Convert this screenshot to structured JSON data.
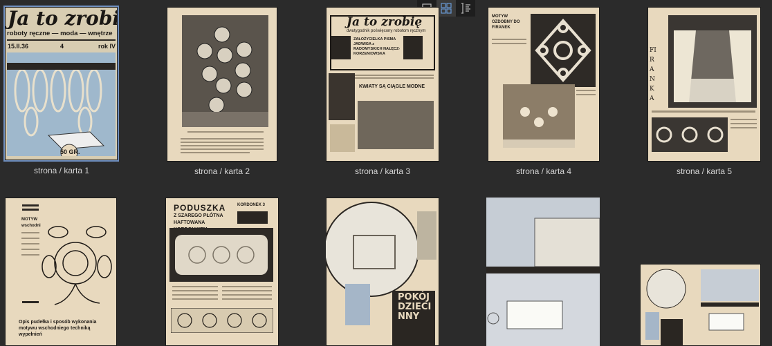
{
  "toolbar": {
    "single_view_label": "single page view",
    "grid_view_label": "grid view",
    "list_view_label": "list view"
  },
  "cover": {
    "title": "Ja to zrobię",
    "subtitle": "roboty ręczne — moda — wnętrze",
    "date": "15.II.36",
    "issue": "4",
    "year": "rok IV",
    "price": "50 GR."
  },
  "page3": {
    "title": "Ja to zrobię",
    "subtitle": "dwutygodnik poświęcony robotom ręcznym",
    "founder": "ZAŁOŻYCIELKA PISMA JADWIGA z RADOMYSKICH NAŁĘCZ-KORZENIOWSKA",
    "headline": "KWIATY SĄ CIĄGLE MODNE"
  },
  "page4": {
    "heading": "MOTYW OZDOBNY DO FIRANEK"
  },
  "page5": {
    "vertical_title": "FIRANKA"
  },
  "page6": {
    "heading": "MOTYW wschodni",
    "footer": "Opis pudełka i sposób wykonania motywu wschodniego techniką wypełnień"
  },
  "page7": {
    "title": "PODUSZKA",
    "subtitle": "Z SZAREGO PŁÓTNA HAFTOWANA KORDONKIEM",
    "brand": "KORDONEK 3"
  },
  "page8": {
    "title": "POKÓJ DZIECINNY"
  },
  "captions": [
    "strona / karta 1",
    "strona / karta 2",
    "strona / karta 3",
    "strona / karta 4",
    "strona / karta 5"
  ]
}
